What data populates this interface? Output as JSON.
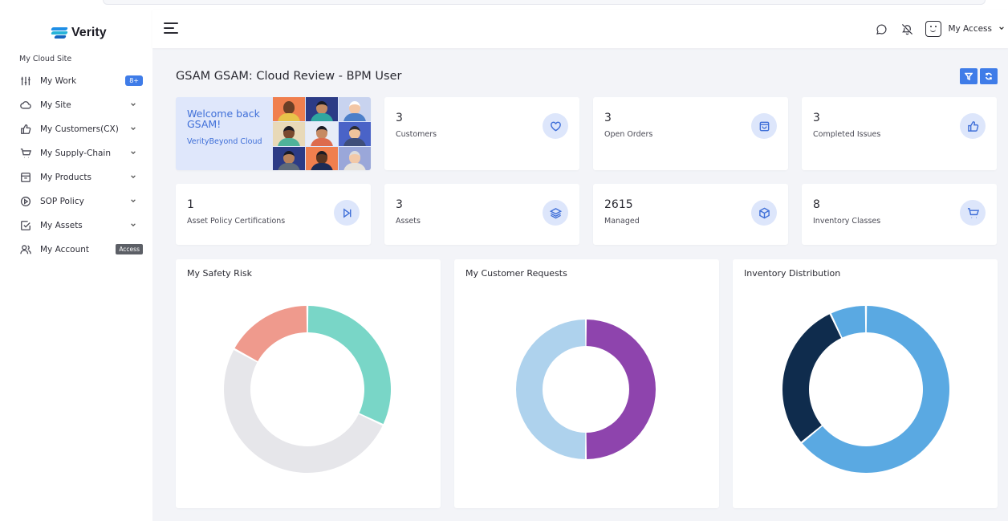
{
  "brand": {
    "name": "Verity"
  },
  "sidebar": {
    "section_title": "My Cloud Site",
    "items": [
      {
        "label": "My Work",
        "icon": "sliders-icon",
        "badge": "8+"
      },
      {
        "label": "My Site",
        "icon": "cloud-icon"
      },
      {
        "label": "My Customers(CX)",
        "icon": "thumbs-up-icon"
      },
      {
        "label": "My Supply-Chain",
        "icon": "cart-icon"
      },
      {
        "label": "My Products",
        "icon": "box-icon"
      },
      {
        "label": "SOP Policy",
        "icon": "play-circle-icon"
      },
      {
        "label": "My Assets",
        "icon": "checkbox-icon"
      },
      {
        "label": "My Account",
        "icon": "users-icon",
        "badge": "Access"
      }
    ]
  },
  "header": {
    "account_label": "My Access"
  },
  "page": {
    "title": "GSAM GSAM: Cloud Review - BPM User"
  },
  "welcome": {
    "title": "Welcome back GSAM!",
    "subtitle": "VerityBeyond Cloud"
  },
  "stats": [
    {
      "value": "3",
      "label": "Customers",
      "icon": "heart-icon"
    },
    {
      "value": "3",
      "label": "Open Orders",
      "icon": "shopping-bag-icon"
    },
    {
      "value": "3",
      "label": "Completed Issues",
      "icon": "thumbs-up-icon"
    },
    {
      "value": "1",
      "label": "Asset Policy Certifications",
      "icon": "skip-forward-icon"
    },
    {
      "value": "3",
      "label": "Assets",
      "icon": "layers-icon"
    },
    {
      "value": "2615",
      "label": "Managed",
      "icon": "package-icon"
    },
    {
      "value": "8",
      "label": "Inventory Classes",
      "icon": "cart-icon"
    }
  ],
  "colors": {
    "accent": "#3f7ce8",
    "teal": "#79d6c7",
    "salmon": "#ef9a8d",
    "gray": "#e6e6ea",
    "purple": "#8e44ad",
    "lightblue": "#aed2ed",
    "blue": "#5aa9e2",
    "navy": "#0f2c4d"
  },
  "panels": [
    {
      "title": "My Safety Risk"
    },
    {
      "title": "My Customer Requests"
    },
    {
      "title": "Inventory Distribution"
    }
  ],
  "chart_data": [
    {
      "type": "pie",
      "title": "My Safety Risk",
      "values": [
        32,
        51,
        17
      ],
      "colors": [
        "#79d6c7",
        "#e6e6ea",
        "#ef9a8d"
      ]
    },
    {
      "type": "pie",
      "title": "My Customer Requests",
      "values": [
        50,
        50
      ],
      "colors": [
        "#8e44ad",
        "#aed2ed"
      ]
    },
    {
      "type": "pie",
      "title": "Inventory Distribution",
      "values": [
        64,
        29,
        7
      ],
      "colors": [
        "#5aa9e2",
        "#0f2c4d",
        "#5aa9e2"
      ]
    }
  ]
}
